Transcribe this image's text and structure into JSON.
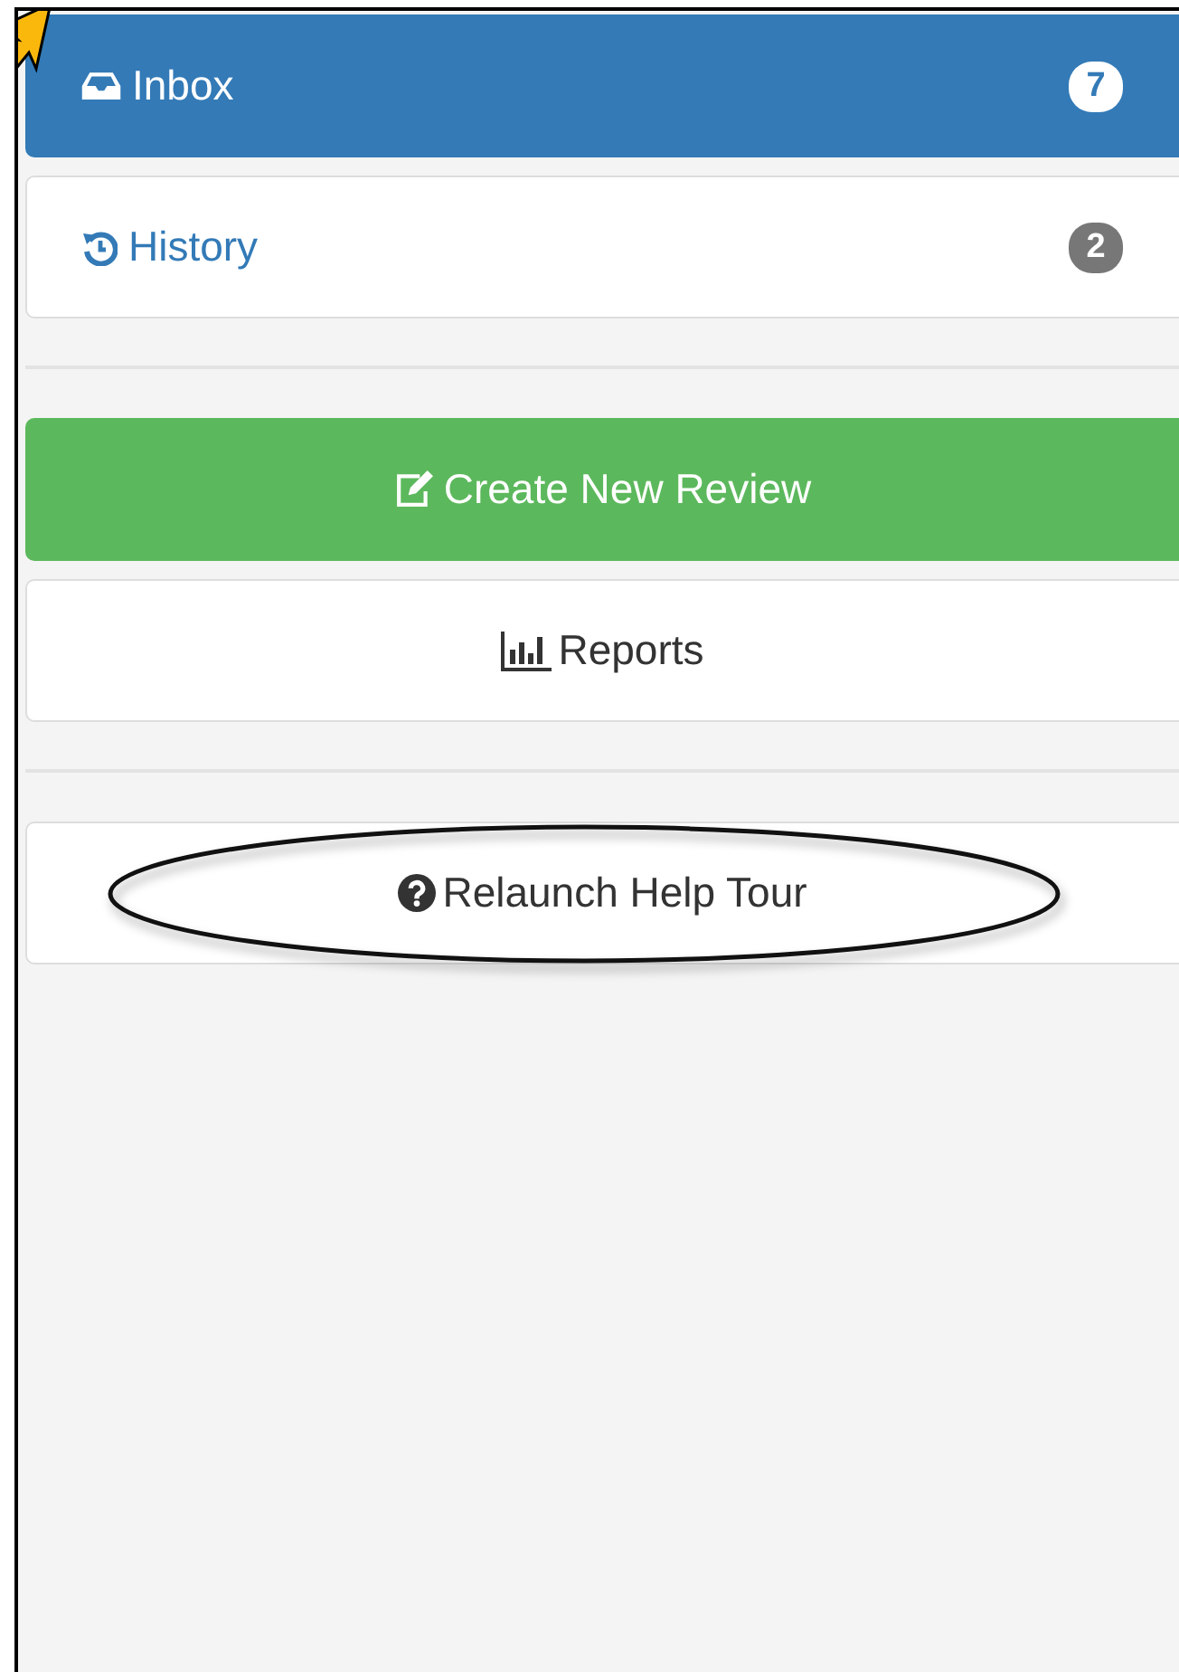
{
  "nav": [
    {
      "label": "Inbox",
      "badge": "7",
      "selected": true
    },
    {
      "label": "History",
      "badge": "2",
      "selected": false
    }
  ],
  "actions": [
    {
      "label": "Create New Review",
      "kind": "primary"
    },
    {
      "label": "Reports",
      "kind": "default"
    }
  ],
  "help": [
    {
      "label": "Relaunch Help Tour",
      "kind": "default",
      "circled": true
    }
  ],
  "pointer_arrow": true
}
